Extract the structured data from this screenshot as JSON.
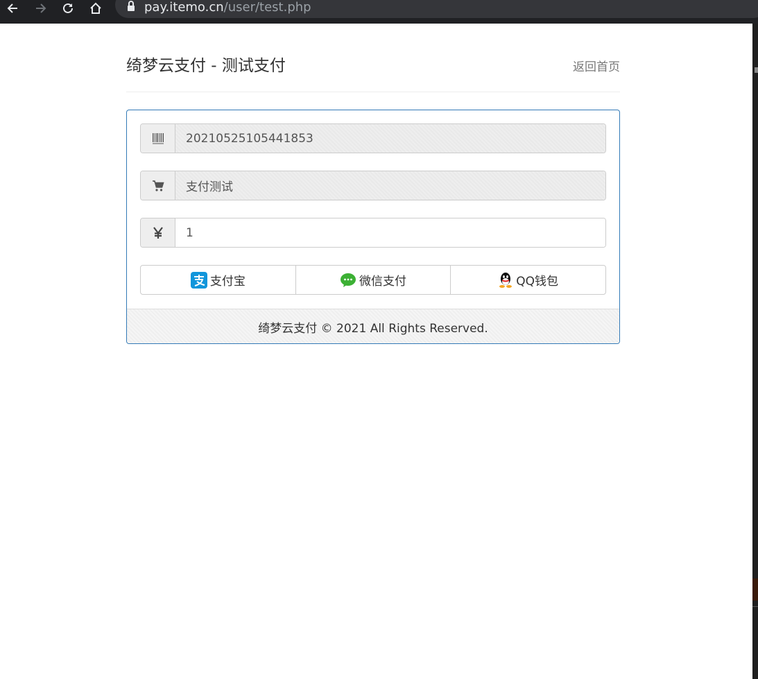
{
  "browser": {
    "url_host": "pay.itemo.cn",
    "url_path": "/user/test.php"
  },
  "header": {
    "title": "绮梦云支付 - 测试支付",
    "home_link": "返回首页"
  },
  "form": {
    "order_no": "20210525105441853",
    "product_name": "支付测试",
    "amount": "1"
  },
  "payment_methods": [
    {
      "label": "支付宝",
      "icon": "alipay-icon",
      "color": "#1296db"
    },
    {
      "label": "微信支付",
      "icon": "wechat-icon",
      "color": "#3cb034"
    },
    {
      "label": "QQ钱包",
      "icon": "qq-icon",
      "color": "#111111"
    }
  ],
  "footer": {
    "copyright": "绮梦云支付 © 2021 All Rights Reserved."
  },
  "colors": {
    "panel_border": "#337ab7",
    "toolbar_bg": "#202124"
  }
}
